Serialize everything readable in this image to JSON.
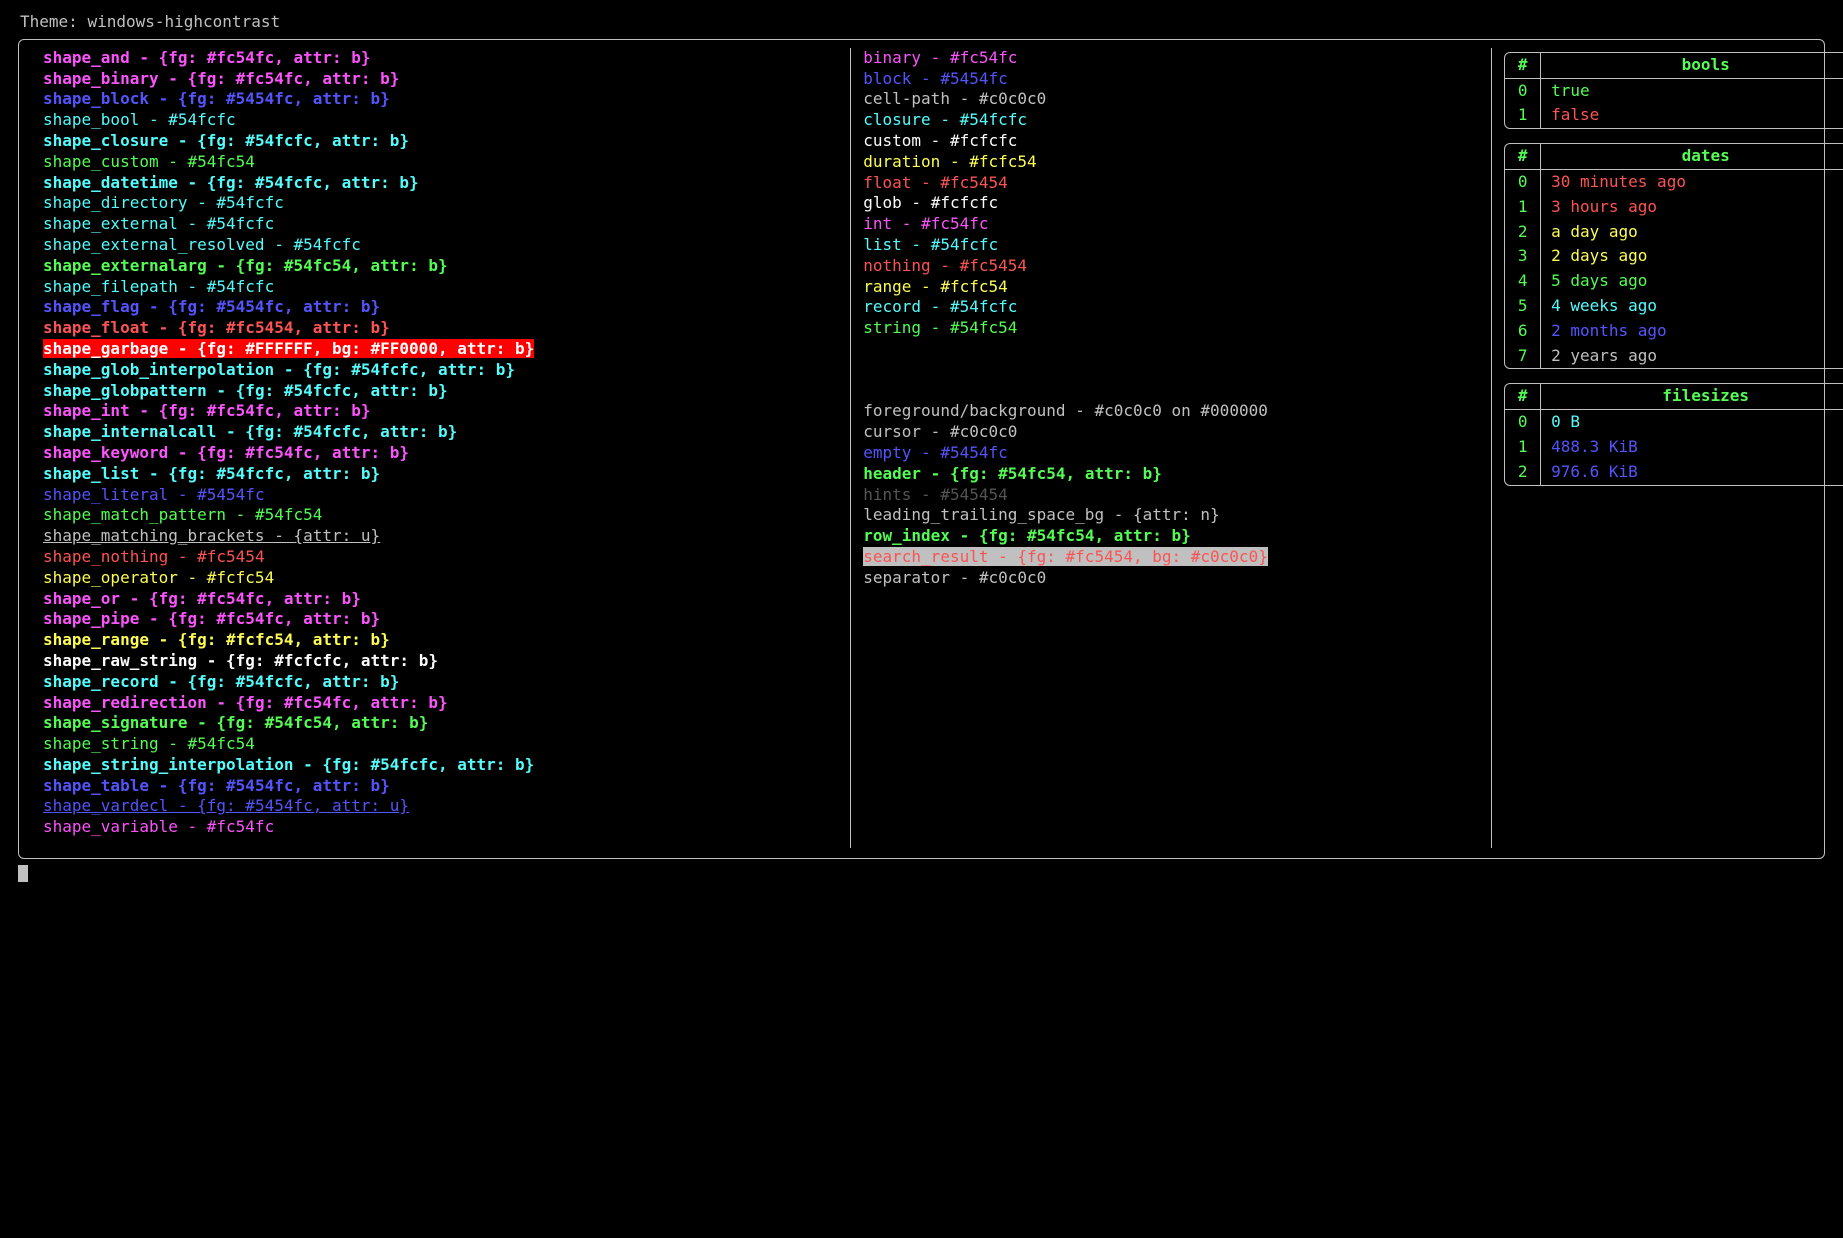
{
  "title_label": "Theme:",
  "title_value": "windows-highcontrast",
  "shapes": [
    {
      "name": "shape_and",
      "value": "{fg: #fc54fc, attr: b}",
      "fg": "#fc54fc",
      "bold": true
    },
    {
      "name": "shape_binary",
      "value": "{fg: #fc54fc, attr: b}",
      "fg": "#fc54fc",
      "bold": true
    },
    {
      "name": "shape_block",
      "value": "{fg: #5454fc, attr: b}",
      "fg": "#5454fc",
      "bold": true
    },
    {
      "name": "shape_bool",
      "value": "#54fcfc",
      "fg": "#54fcfc"
    },
    {
      "name": "shape_closure",
      "value": "{fg: #54fcfc, attr: b}",
      "fg": "#54fcfc",
      "bold": true
    },
    {
      "name": "shape_custom",
      "value": "#54fc54",
      "fg": "#54fc54"
    },
    {
      "name": "shape_datetime",
      "value": "{fg: #54fcfc, attr: b}",
      "fg": "#54fcfc",
      "bold": true
    },
    {
      "name": "shape_directory",
      "value": "#54fcfc",
      "fg": "#54fcfc"
    },
    {
      "name": "shape_external",
      "value": "#54fcfc",
      "fg": "#54fcfc"
    },
    {
      "name": "shape_external_resolved",
      "value": "#54fcfc",
      "fg": "#54fcfc"
    },
    {
      "name": "shape_externalarg",
      "value": "{fg: #54fc54, attr: b}",
      "fg": "#54fc54",
      "bold": true
    },
    {
      "name": "shape_filepath",
      "value": "#54fcfc",
      "fg": "#54fcfc"
    },
    {
      "name": "shape_flag",
      "value": "{fg: #5454fc, attr: b}",
      "fg": "#5454fc",
      "bold": true
    },
    {
      "name": "shape_float",
      "value": "{fg: #fc5454, attr: b}",
      "fg": "#fc5454",
      "bold": true
    },
    {
      "name": "shape_garbage",
      "value": "{fg: #FFFFFF, bg: #FF0000, attr: b}",
      "fg": "#FFFFFF",
      "bg": "#FF0000",
      "bold": true
    },
    {
      "name": "shape_glob_interpolation",
      "value": "{fg: #54fcfc, attr: b}",
      "fg": "#54fcfc",
      "bold": true
    },
    {
      "name": "shape_globpattern",
      "value": "{fg: #54fcfc, attr: b}",
      "fg": "#54fcfc",
      "bold": true
    },
    {
      "name": "shape_int",
      "value": "{fg: #fc54fc, attr: b}",
      "fg": "#fc54fc",
      "bold": true
    },
    {
      "name": "shape_internalcall",
      "value": "{fg: #54fcfc, attr: b}",
      "fg": "#54fcfc",
      "bold": true
    },
    {
      "name": "shape_keyword",
      "value": "{fg: #fc54fc, attr: b}",
      "fg": "#fc54fc",
      "bold": true
    },
    {
      "name": "shape_list",
      "value": "{fg: #54fcfc, attr: b}",
      "fg": "#54fcfc",
      "bold": true
    },
    {
      "name": "shape_literal",
      "value": "#5454fc",
      "fg": "#5454fc"
    },
    {
      "name": "shape_match_pattern",
      "value": "#54fc54",
      "fg": "#54fc54"
    },
    {
      "name": "shape_matching_brackets",
      "value": "{attr: u}",
      "fg": "#c0c0c0",
      "underline": true
    },
    {
      "name": "shape_nothing",
      "value": "#fc5454",
      "fg": "#fc5454"
    },
    {
      "name": "shape_operator",
      "value": "#fcfc54",
      "fg": "#fcfc54"
    },
    {
      "name": "shape_or",
      "value": "{fg: #fc54fc, attr: b}",
      "fg": "#fc54fc",
      "bold": true
    },
    {
      "name": "shape_pipe",
      "value": "{fg: #fc54fc, attr: b}",
      "fg": "#fc54fc",
      "bold": true
    },
    {
      "name": "shape_range",
      "value": "{fg: #fcfc54, attr: b}",
      "fg": "#fcfc54",
      "bold": true
    },
    {
      "name": "shape_raw_string",
      "value": "{fg: #fcfcfc, attr: b}",
      "fg": "#fcfcfc",
      "bold": true
    },
    {
      "name": "shape_record",
      "value": "{fg: #54fcfc, attr: b}",
      "fg": "#54fcfc",
      "bold": true
    },
    {
      "name": "shape_redirection",
      "value": "{fg: #fc54fc, attr: b}",
      "fg": "#fc54fc",
      "bold": true
    },
    {
      "name": "shape_signature",
      "value": "{fg: #54fc54, attr: b}",
      "fg": "#54fc54",
      "bold": true
    },
    {
      "name": "shape_string",
      "value": "#54fc54",
      "fg": "#54fc54"
    },
    {
      "name": "shape_string_interpolation",
      "value": "{fg: #54fcfc, attr: b}",
      "fg": "#54fcfc",
      "bold": true
    },
    {
      "name": "shape_table",
      "value": "{fg: #5454fc, attr: b}",
      "fg": "#5454fc",
      "bold": true
    },
    {
      "name": "shape_vardecl",
      "value": "{fg: #5454fc, attr: u}",
      "fg": "#5454fc",
      "underline": true
    },
    {
      "name": "shape_variable",
      "value": "#fc54fc",
      "fg": "#fc54fc"
    }
  ],
  "types": [
    {
      "name": "binary",
      "value": "#fc54fc",
      "fg": "#fc54fc"
    },
    {
      "name": "block",
      "value": "#5454fc",
      "fg": "#5454fc"
    },
    {
      "name": "cell-path",
      "value": "#c0c0c0",
      "fg": "#c0c0c0"
    },
    {
      "name": "closure",
      "value": "#54fcfc",
      "fg": "#54fcfc"
    },
    {
      "name": "custom",
      "value": "#fcfcfc",
      "fg": "#fcfcfc"
    },
    {
      "name": "duration",
      "value": "#fcfc54",
      "fg": "#fcfc54"
    },
    {
      "name": "float",
      "value": "#fc5454",
      "fg": "#fc5454"
    },
    {
      "name": "glob",
      "value": "#fcfcfc",
      "fg": "#fcfcfc"
    },
    {
      "name": "int",
      "value": "#fc54fc",
      "fg": "#fc54fc"
    },
    {
      "name": "list",
      "value": "#54fcfc",
      "fg": "#54fcfc"
    },
    {
      "name": "nothing",
      "value": "#fc5454",
      "fg": "#fc5454"
    },
    {
      "name": "range",
      "value": "#fcfc54",
      "fg": "#fcfc54"
    },
    {
      "name": "record",
      "value": "#54fcfc",
      "fg": "#54fcfc"
    },
    {
      "name": "string",
      "value": "#54fc54",
      "fg": "#54fc54"
    }
  ],
  "misc": [
    {
      "name": "foreground/background",
      "value": "#c0c0c0 on #000000",
      "fg": "#c0c0c0"
    },
    {
      "name": "cursor",
      "value": "#c0c0c0",
      "fg": "#c0c0c0"
    },
    {
      "name": "empty",
      "value": "#5454fc",
      "fg": "#5454fc"
    },
    {
      "name": "header",
      "value": "{fg: #54fc54, attr: b}",
      "fg": "#54fc54",
      "bold": true
    },
    {
      "name": "hints",
      "value": "#545454",
      "fg": "#545454"
    },
    {
      "name": "leading_trailing_space_bg",
      "value": "{attr: n}",
      "fg": "#c0c0c0"
    },
    {
      "name": "row_index",
      "value": "{fg: #54fc54, attr: b}",
      "fg": "#54fc54",
      "bold": true
    },
    {
      "name": "search_result",
      "value": "{fg: #fc5454, bg: #c0c0c0}",
      "fg": "#fc5454",
      "bg": "#c0c0c0"
    },
    {
      "name": "separator",
      "value": "#c0c0c0",
      "fg": "#c0c0c0"
    }
  ],
  "tables": {
    "bools": {
      "header": "bools",
      "rows": [
        {
          "idx": "0",
          "text": "true",
          "color": "#54fc54"
        },
        {
          "idx": "1",
          "text": "false",
          "color": "#fc5454"
        }
      ]
    },
    "dates": {
      "header": "dates",
      "rows": [
        {
          "idx": "0",
          "text": "30 minutes ago",
          "color": "#fc5454"
        },
        {
          "idx": "1",
          "text": "3 hours ago",
          "color": "#fc5454"
        },
        {
          "idx": "2",
          "text": "a day ago",
          "color": "#fcfc54"
        },
        {
          "idx": "3",
          "text": "2 days ago",
          "color": "#fcfc54"
        },
        {
          "idx": "4",
          "text": "5 days ago",
          "color": "#54fc54"
        },
        {
          "idx": "5",
          "text": "4 weeks ago",
          "color": "#54fcfc"
        },
        {
          "idx": "6",
          "text": "2 months ago",
          "color": "#5454fc"
        },
        {
          "idx": "7",
          "text": "2 years ago",
          "color": "#c0c0c0"
        }
      ]
    },
    "filesizes": {
      "header": "filesizes",
      "rows": [
        {
          "idx": "0",
          "text": "0 B",
          "color": "#54fcfc"
        },
        {
          "idx": "1",
          "text": "488.3 KiB",
          "color": "#5454fc"
        },
        {
          "idx": "2",
          "text": "976.6 KiB",
          "color": "#5454fc"
        }
      ]
    }
  }
}
